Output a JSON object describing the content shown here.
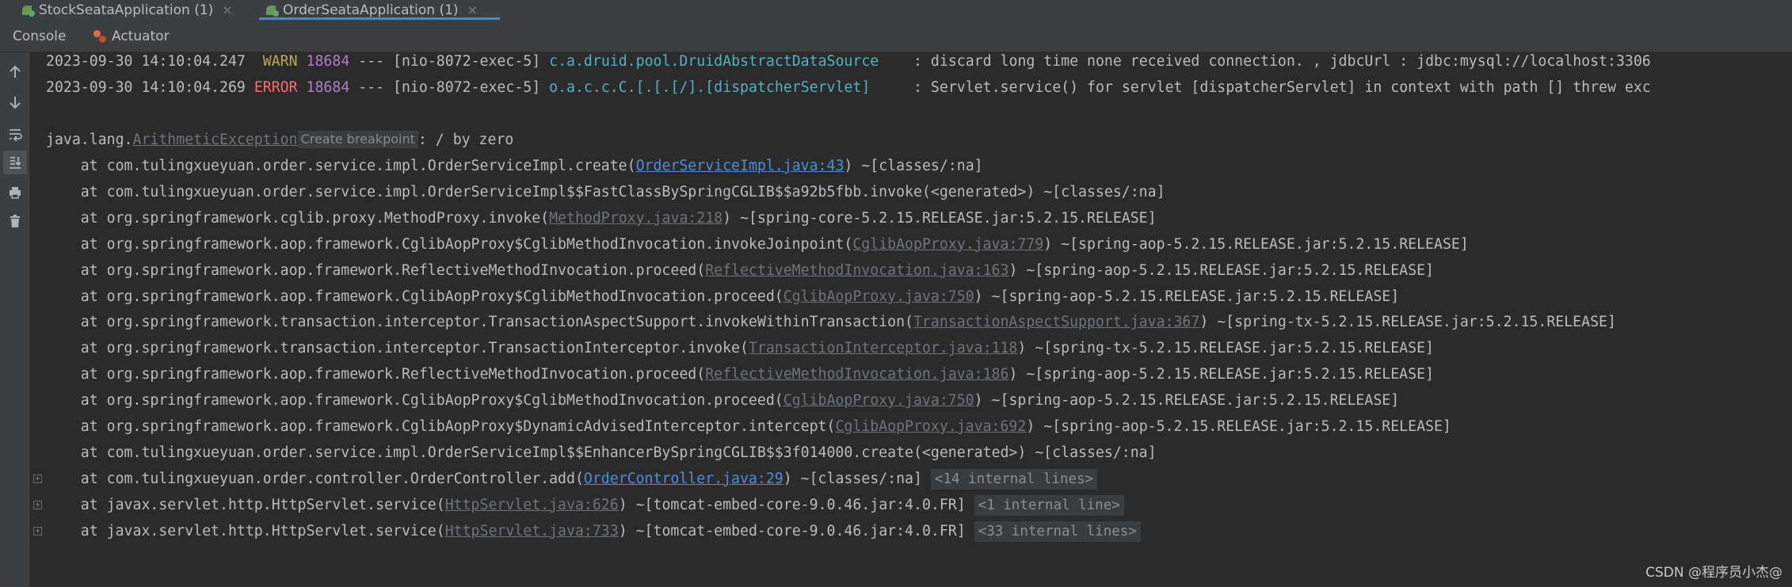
{
  "tabs": [
    {
      "label": "StockSeataApplication (1)",
      "active": false
    },
    {
      "label": "OrderSeataApplication (1)",
      "active": true
    }
  ],
  "close_glyph": "×",
  "subtabs": {
    "console": "Console",
    "actuator": "Actuator"
  },
  "toolbar_icons": [
    "up-arrow-icon",
    "down-arrow-icon",
    "soft-wrap-icon",
    "scroll-to-end-icon",
    "print-icon",
    "clear-all-icon"
  ],
  "log": {
    "warn_line": {
      "timestamp": "2023-09-30 14:10:04.247",
      "level": " WARN",
      "pid": "18684",
      "sep": " --- ",
      "thread": "[nio-8072-exec-5]",
      "logger": "c.a.druid.pool.DruidAbstractDataSource  ",
      "message": "  : discard long time none received connection. , jdbcUrl : jdbc:mysql://localhost:3306"
    },
    "error_line": {
      "timestamp": "2023-09-30 14:10:04.269",
      "level": "ERROR",
      "pid": "18684",
      "sep": " --- ",
      "thread": "[nio-8072-exec-5]",
      "logger": "o.a.c.c.C.[.[.[/].[dispatcherServlet]   ",
      "message": "  : Servlet.service() for servlet [dispatcherServlet] in context with path [] threw exc"
    },
    "exception": {
      "prefix": "java.lang.",
      "class": "ArithmeticException",
      "breakpoint": "Create breakpoint",
      "message": ": / by zero"
    },
    "stack": [
      {
        "pre": "    at com.tulingxueyuan.order.service.impl.OrderServiceImpl.create(",
        "link": "OrderServiceImpl.java:43",
        "style": "blue",
        "post": ") ~[classes/:na]"
      },
      {
        "pre": "    at com.tulingxueyuan.order.service.impl.OrderServiceImpl$$FastClassBySpringCGLIB$$a92b5fbb.invoke(<generated>) ~[classes/:na]",
        "link": "",
        "style": "",
        "post": ""
      },
      {
        "pre": "    at org.springframework.cglib.proxy.MethodProxy.invoke(",
        "link": "MethodProxy.java:218",
        "style": "gray",
        "post": ") ~[spring-core-5.2.15.RELEASE.jar:5.2.15.RELEASE]"
      },
      {
        "pre": "    at org.springframework.aop.framework.CglibAopProxy$CglibMethodInvocation.invokeJoinpoint(",
        "link": "CglibAopProxy.java:779",
        "style": "gray",
        "post": ") ~[spring-aop-5.2.15.RELEASE.jar:5.2.15.RELEASE]"
      },
      {
        "pre": "    at org.springframework.aop.framework.ReflectiveMethodInvocation.proceed(",
        "link": "ReflectiveMethodInvocation.java:163",
        "style": "gray",
        "post": ") ~[spring-aop-5.2.15.RELEASE.jar:5.2.15.RELEASE]"
      },
      {
        "pre": "    at org.springframework.aop.framework.CglibAopProxy$CglibMethodInvocation.proceed(",
        "link": "CglibAopProxy.java:750",
        "style": "gray",
        "post": ") ~[spring-aop-5.2.15.RELEASE.jar:5.2.15.RELEASE]"
      },
      {
        "pre": "    at org.springframework.transaction.interceptor.TransactionAspectSupport.invokeWithinTransaction(",
        "link": "TransactionAspectSupport.java:367",
        "style": "gray",
        "post": ") ~[spring-tx-5.2.15.RELEASE.jar:5.2.15.RELEASE]"
      },
      {
        "pre": "    at org.springframework.transaction.interceptor.TransactionInterceptor.invoke(",
        "link": "TransactionInterceptor.java:118",
        "style": "gray",
        "post": ") ~[spring-tx-5.2.15.RELEASE.jar:5.2.15.RELEASE]"
      },
      {
        "pre": "    at org.springframework.aop.framework.ReflectiveMethodInvocation.proceed(",
        "link": "ReflectiveMethodInvocation.java:186",
        "style": "gray",
        "post": ") ~[spring-aop-5.2.15.RELEASE.jar:5.2.15.RELEASE]"
      },
      {
        "pre": "    at org.springframework.aop.framework.CglibAopProxy$CglibMethodInvocation.proceed(",
        "link": "CglibAopProxy.java:750",
        "style": "gray",
        "post": ") ~[spring-aop-5.2.15.RELEASE.jar:5.2.15.RELEASE]"
      },
      {
        "pre": "    at org.springframework.aop.framework.CglibAopProxy$DynamicAdvisedInterceptor.intercept(",
        "link": "CglibAopProxy.java:692",
        "style": "gray",
        "post": ") ~[spring-aop-5.2.15.RELEASE.jar:5.2.15.RELEASE]"
      },
      {
        "pre": "    at com.tulingxueyuan.order.service.impl.OrderServiceImpl$$EnhancerBySpringCGLIB$$3f014000.create(<generated>) ~[classes/:na]",
        "link": "",
        "style": "",
        "post": ""
      },
      {
        "pre": "    at com.tulingxueyuan.order.controller.OrderController.add(",
        "link": "OrderController.java:29",
        "style": "blue",
        "post": ") ~[classes/:na] ",
        "internal": "<14 internal lines>"
      },
      {
        "pre": "    at javax.servlet.http.HttpServlet.service(",
        "link": "HttpServlet.java:626",
        "style": "gray",
        "post": ") ~[tomcat-embed-core-9.0.46.jar:4.0.FR] ",
        "internal": "<1 internal line>"
      },
      {
        "pre": "    at javax.servlet.http.HttpServlet.service(",
        "link": "HttpServlet.java:733",
        "style": "gray",
        "post": ") ~[tomcat-embed-core-9.0.46.jar:4.0.FR] ",
        "internal": "<33 internal lines>"
      }
    ]
  },
  "watermark": "CSDN @程序员小杰@"
}
